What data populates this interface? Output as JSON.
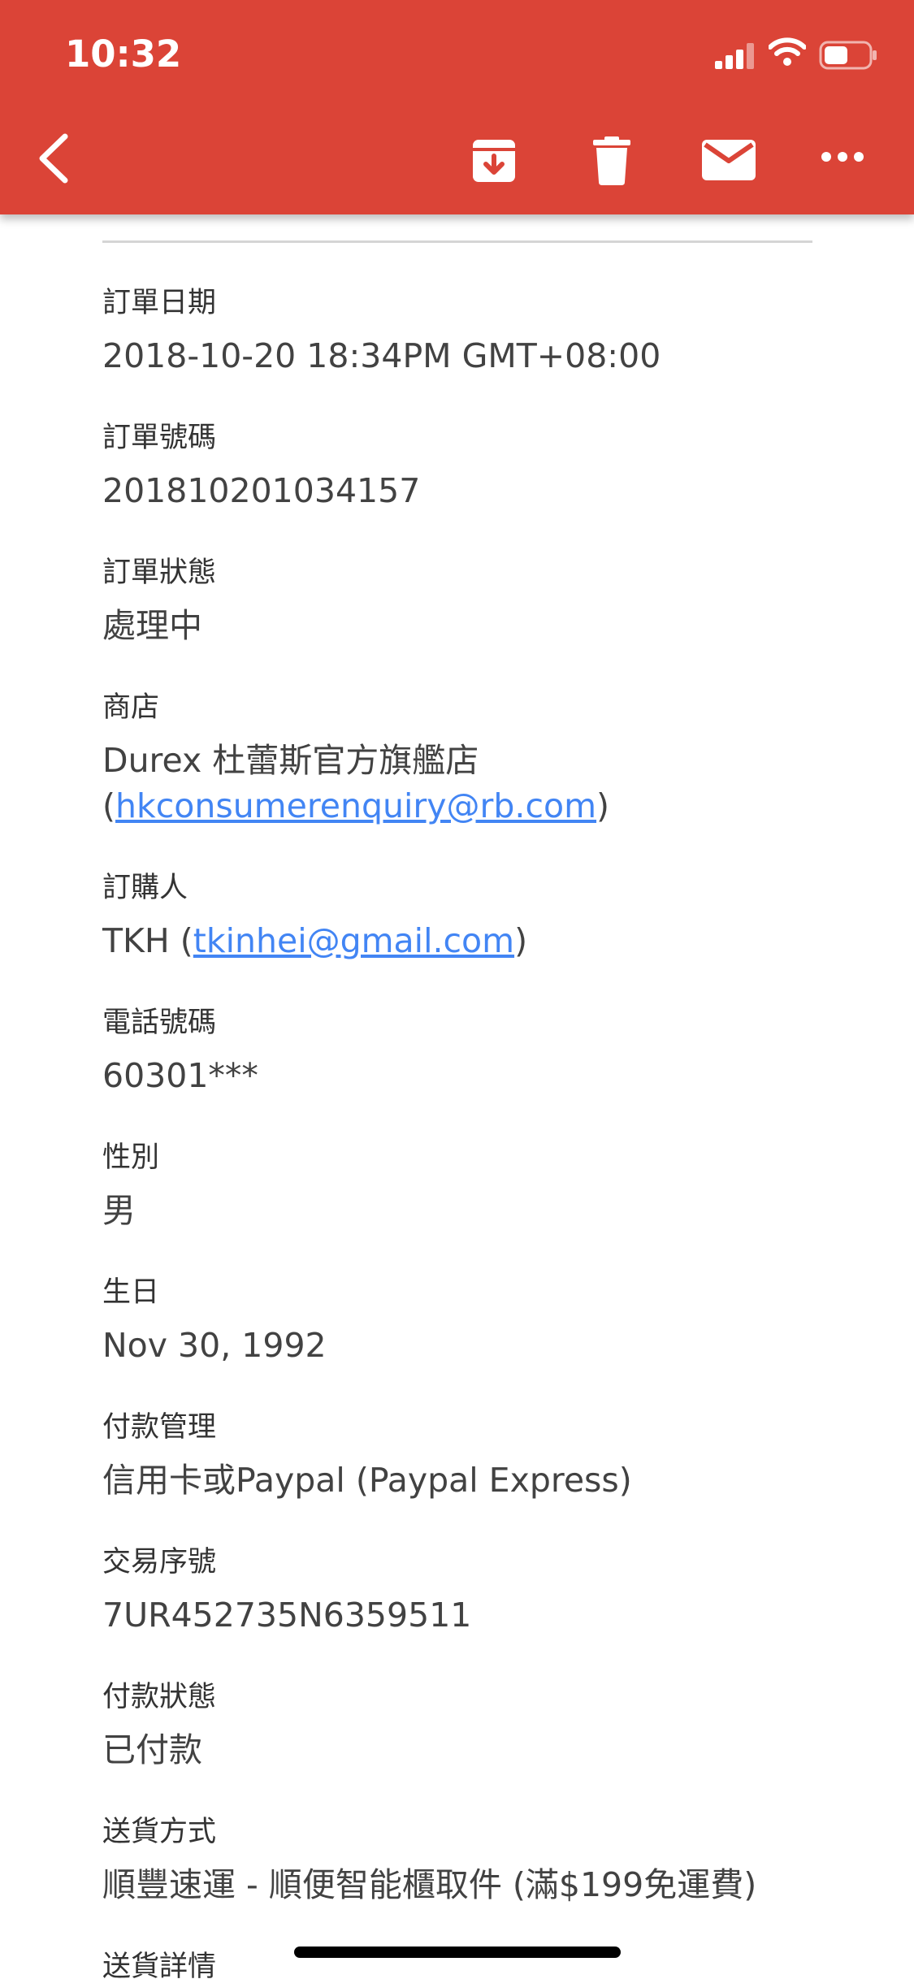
{
  "status_bar": {
    "time": "10:32"
  },
  "colors": {
    "header": "#db4437",
    "link": "#4285f4"
  },
  "toolbar": {
    "icons": [
      "back-icon",
      "archive-icon",
      "delete-icon",
      "mail-icon",
      "more-icon"
    ]
  },
  "order": {
    "date": {
      "label": "訂單日期",
      "value": "2018-10-20 18:34PM GMT+08:00"
    },
    "number": {
      "label": "訂單號碼",
      "value": "201810201034157"
    },
    "status": {
      "label": "訂單狀態",
      "value": "處理中"
    },
    "store": {
      "label": "商店",
      "name": "Durex 杜蕾斯官方旗艦店",
      "email_prefix": "(",
      "email": "hkconsumerenquiry@rb.com",
      "email_suffix": ")"
    },
    "buyer": {
      "label": "訂購人",
      "name": "TKH (",
      "email": "tkinhei@gmail.com",
      "suffix": ")"
    },
    "phone": {
      "label": "電話號碼",
      "value": "60301***"
    },
    "gender": {
      "label": "性別",
      "value": "男"
    },
    "birthday": {
      "label": "生日",
      "value": "Nov 30, 1992"
    },
    "payment_method": {
      "label": "付款管理",
      "value": "信用卡或Paypal (Paypal Express)"
    },
    "transaction": {
      "label": "交易序號",
      "value": "7UR452735N6359511"
    },
    "payment_status": {
      "label": "付款狀態",
      "value": "已付款"
    },
    "shipping_method": {
      "label": "送貨方式",
      "value": "順豐速運 - 順便智能櫃取件 (滿$199免運費)"
    },
    "shipping_details": {
      "label": "送貨詳情"
    }
  }
}
